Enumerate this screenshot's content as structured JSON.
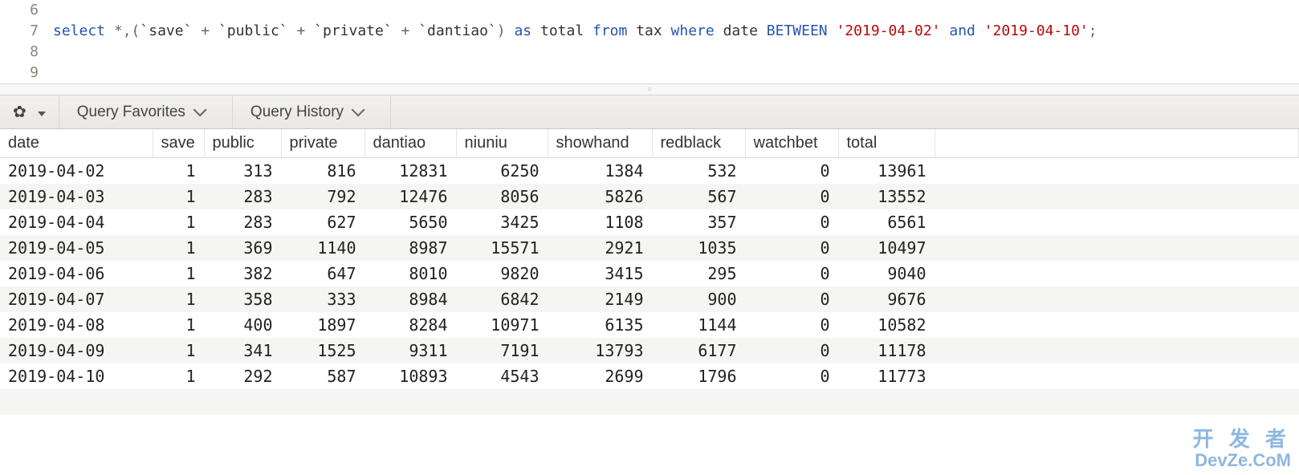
{
  "editor": {
    "visible_lines": [
      6,
      7,
      8,
      9
    ],
    "code_line": 7,
    "tokens": [
      {
        "t": "select",
        "c": "kw"
      },
      {
        "t": " *,(",
        "c": "sym"
      },
      {
        "t": "`save`",
        "c": "ident"
      },
      {
        "t": " + ",
        "c": "sym"
      },
      {
        "t": "`public`",
        "c": "ident"
      },
      {
        "t": " + ",
        "c": "sym"
      },
      {
        "t": "`private`",
        "c": "ident"
      },
      {
        "t": " + ",
        "c": "sym"
      },
      {
        "t": "`dantiao`",
        "c": "ident"
      },
      {
        "t": ") ",
        "c": "sym"
      },
      {
        "t": "as",
        "c": "kw"
      },
      {
        "t": " total ",
        "c": "ident"
      },
      {
        "t": "from",
        "c": "kw"
      },
      {
        "t": " tax ",
        "c": "ident"
      },
      {
        "t": "where",
        "c": "kw"
      },
      {
        "t": " date ",
        "c": "ident"
      },
      {
        "t": "BETWEEN",
        "c": "kw"
      },
      {
        "t": " ",
        "c": "sym"
      },
      {
        "t": "'2019-04-02'",
        "c": "str"
      },
      {
        "t": " ",
        "c": "sym"
      },
      {
        "t": "and",
        "c": "kw"
      },
      {
        "t": " ",
        "c": "sym"
      },
      {
        "t": "'2019-04-10'",
        "c": "str"
      },
      {
        "t": ";",
        "c": "sym"
      }
    ]
  },
  "toolbar": {
    "gear_label": "",
    "favorites_label": "Query Favorites",
    "history_label": "Query History"
  },
  "results": {
    "columns": [
      "date",
      "save",
      "public",
      "private",
      "dantiao",
      "niuniu",
      "showhand",
      "redblack",
      "watchbet",
      "total"
    ],
    "rows": [
      {
        "date": "2019-04-02",
        "save": 1,
        "public": 313,
        "private": 816,
        "dantiao": 12831,
        "niuniu": 6250,
        "showhand": 1384,
        "redblack": 532,
        "watchbet": 0,
        "total": 13961
      },
      {
        "date": "2019-04-03",
        "save": 1,
        "public": 283,
        "private": 792,
        "dantiao": 12476,
        "niuniu": 8056,
        "showhand": 5826,
        "redblack": 567,
        "watchbet": 0,
        "total": 13552
      },
      {
        "date": "2019-04-04",
        "save": 1,
        "public": 283,
        "private": 627,
        "dantiao": 5650,
        "niuniu": 3425,
        "showhand": 1108,
        "redblack": 357,
        "watchbet": 0,
        "total": 6561
      },
      {
        "date": "2019-04-05",
        "save": 1,
        "public": 369,
        "private": 1140,
        "dantiao": 8987,
        "niuniu": 15571,
        "showhand": 2921,
        "redblack": 1035,
        "watchbet": 0,
        "total": 10497
      },
      {
        "date": "2019-04-06",
        "save": 1,
        "public": 382,
        "private": 647,
        "dantiao": 8010,
        "niuniu": 9820,
        "showhand": 3415,
        "redblack": 295,
        "watchbet": 0,
        "total": 9040
      },
      {
        "date": "2019-04-07",
        "save": 1,
        "public": 358,
        "private": 333,
        "dantiao": 8984,
        "niuniu": 6842,
        "showhand": 2149,
        "redblack": 900,
        "watchbet": 0,
        "total": 9676
      },
      {
        "date": "2019-04-08",
        "save": 1,
        "public": 400,
        "private": 1897,
        "dantiao": 8284,
        "niuniu": 10971,
        "showhand": 6135,
        "redblack": 1144,
        "watchbet": 0,
        "total": 10582
      },
      {
        "date": "2019-04-09",
        "save": 1,
        "public": 341,
        "private": 1525,
        "dantiao": 9311,
        "niuniu": 7191,
        "showhand": 13793,
        "redblack": 6177,
        "watchbet": 0,
        "total": 11178
      },
      {
        "date": "2019-04-10",
        "save": 1,
        "public": 292,
        "private": 587,
        "dantiao": 10893,
        "niuniu": 4543,
        "showhand": 2699,
        "redblack": 1796,
        "watchbet": 0,
        "total": 11773
      }
    ]
  },
  "watermark": {
    "cn": "开 发 者",
    "en": "DevZe.CoM"
  }
}
